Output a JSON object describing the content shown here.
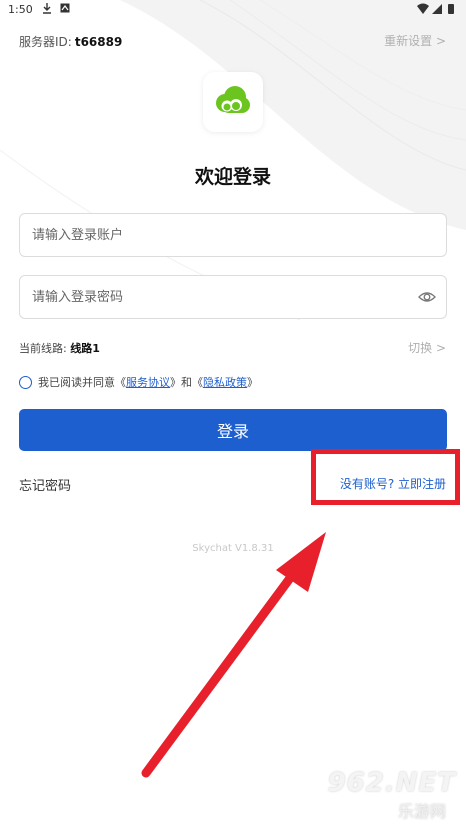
{
  "status_bar": {
    "time": "1:50"
  },
  "server": {
    "label": "服务器ID:",
    "id": "t66889",
    "reset": "重新设置 >"
  },
  "title": "欢迎登录",
  "account_input": {
    "placeholder": "请输入登录账户"
  },
  "password_input": {
    "placeholder": "请输入登录密码"
  },
  "line": {
    "label": "当前线路:",
    "value": "线路1",
    "switch": "切换 >"
  },
  "agreement": {
    "prefix": "我已阅读并同意《",
    "terms": "服务协议",
    "mid": "》和《",
    "privacy": "隐私政策",
    "suffix": "》"
  },
  "login_button": "登录",
  "forgot_password": "忘记密码",
  "register": "没有账号? 立即注册",
  "version": "Skychat V1.8.31",
  "watermark": {
    "brand": "962.NET",
    "url": "乐游网"
  },
  "colors": {
    "accent": "#1e5fcf",
    "highlight": "#e8202b",
    "logo_green": "#6cc51f"
  }
}
